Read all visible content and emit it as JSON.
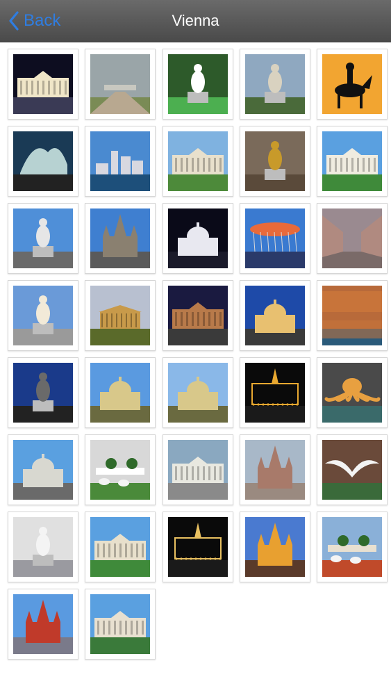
{
  "nav": {
    "back_label": "Back",
    "title": "Vienna",
    "accent_color": "#2f7de1"
  },
  "photos": [
    {
      "name": "parliament-night",
      "sky": "#0d0d20",
      "ground": "#3a3a55",
      "subject": "#f0e6c8",
      "kind": "building"
    },
    {
      "name": "belvedere-garden-cloudy",
      "sky": "#9aa5a8",
      "ground": "#7a8b55",
      "subject": "#c8c8c0",
      "kind": "landscape"
    },
    {
      "name": "mozart-statue",
      "sky": "#2d5a2a",
      "ground": "#4caf50",
      "subject": "#ffffff",
      "kind": "statue"
    },
    {
      "name": "strauss-monument",
      "sky": "#8fa8c0",
      "ground": "#4a6a3a",
      "subject": "#d9d2c0",
      "kind": "monument"
    },
    {
      "name": "equestrian-silhouette",
      "sky": "#f2a531",
      "ground": "#f2a531",
      "subject": "#111111",
      "kind": "silhouette"
    },
    {
      "name": "fountain-night",
      "sky": "#1a3a55",
      "ground": "#222222",
      "subject": "#c9e3e0",
      "kind": "fountain"
    },
    {
      "name": "danube-city",
      "sky": "#4a8ad0",
      "ground": "#1d4f7a",
      "subject": "#d8d8e0",
      "kind": "city"
    },
    {
      "name": "schonbrunn-palace",
      "sky": "#7fb2e0",
      "ground": "#4d8a3a",
      "subject": "#e8e0cc",
      "kind": "palace"
    },
    {
      "name": "golden-sculpture",
      "sky": "#7a6a5a",
      "ground": "#5a4a3a",
      "subject": "#c89a2a",
      "kind": "sculpture"
    },
    {
      "name": "belvedere-blue-sky",
      "sky": "#5aa0e0",
      "ground": "#3f8a3a",
      "subject": "#f0ece0",
      "kind": "palace"
    },
    {
      "name": "pallas-athene-fountain",
      "sky": "#4f8fd8",
      "ground": "#6a6a6a",
      "subject": "#e6e6e6",
      "kind": "statue"
    },
    {
      "name": "st-stephens-cathedral",
      "sky": "#3f7fd0",
      "ground": "#5a5a5a",
      "subject": "#8a8070",
      "kind": "church"
    },
    {
      "name": "karlskirche-night",
      "sky": "#0a0a18",
      "ground": "#1a1a2a",
      "subject": "#e8e8f0",
      "kind": "dome"
    },
    {
      "name": "prater-swing-ride",
      "sky": "#3a7ad0",
      "ground": "#2a3a6a",
      "subject": "#e86a3a",
      "kind": "ride"
    },
    {
      "name": "kartner-strasse",
      "sky": "#9a8a90",
      "ground": "#7a6a68",
      "subject": "#b08a80",
      "kind": "street"
    },
    {
      "name": "athena-statue",
      "sky": "#6a9ad8",
      "ground": "#9a9a9a",
      "subject": "#f2ead8",
      "kind": "statue"
    },
    {
      "name": "theseus-temple",
      "sky": "#b8c0d0",
      "ground": "#5a6a2a",
      "subject": "#c89a4a",
      "kind": "temple"
    },
    {
      "name": "opera-evening",
      "sky": "#1a1a40",
      "ground": "#3a3a3a",
      "subject": "#b87a4a",
      "kind": "building"
    },
    {
      "name": "natural-history-museum",
      "sky": "#1e4aa8",
      "ground": "#3a3a3a",
      "subject": "#e8c070",
      "kind": "dome"
    },
    {
      "name": "reflecting-building",
      "sky": "#b86a3a",
      "ground": "#2a5a7a",
      "subject": "#c8743a",
      "kind": "reflection"
    },
    {
      "name": "statue-blue-night",
      "sky": "#1a3a8a",
      "ground": "#222222",
      "subject": "#6a6a6a",
      "kind": "statue"
    },
    {
      "name": "hofburg-dome",
      "sky": "#5a9ae0",
      "ground": "#6a6a40",
      "subject": "#d8c88a",
      "kind": "dome"
    },
    {
      "name": "hofburg-green-dome",
      "sky": "#8ab8e8",
      "ground": "#6a6a40",
      "subject": "#d8c88a",
      "kind": "dome"
    },
    {
      "name": "rathaus-night",
      "sky": "#0a0a0a",
      "ground": "#1a1a1a",
      "subject": "#e8a830",
      "kind": "lights"
    },
    {
      "name": "octopus-fountain",
      "sky": "#4a4a4a",
      "ground": "#3a6a6a",
      "subject": "#e8a040",
      "kind": "octopus"
    },
    {
      "name": "karlskirche-day",
      "sky": "#5aa0e0",
      "ground": "#6a6a6a",
      "subject": "#d8d8d0",
      "kind": "dome"
    },
    {
      "name": "garden-flower-pots",
      "sky": "#d8d8d8",
      "ground": "#4a8a3a",
      "subject": "#ffffff",
      "kind": "garden"
    },
    {
      "name": "parliament-day",
      "sky": "#8aa8c0",
      "ground": "#8a8a8a",
      "subject": "#e8e8e0",
      "kind": "building"
    },
    {
      "name": "votivkirche",
      "sky": "#a8b8c8",
      "ground": "#9a8a80",
      "subject": "#a87a6a",
      "kind": "church"
    },
    {
      "name": "seagull-flight",
      "sky": "#6a4a3a",
      "ground": "#3a6a3a",
      "subject": "#f4f4f4",
      "kind": "bird"
    },
    {
      "name": "marble-sculpture",
      "sky": "#e0e0e0",
      "ground": "#9a9aa0",
      "subject": "#f4f4f4",
      "kind": "statue"
    },
    {
      "name": "belvedere-lawn",
      "sky": "#5aa0e0",
      "ground": "#3f8a3a",
      "subject": "#e8e0cc",
      "kind": "palace"
    },
    {
      "name": "colosseum-lights",
      "sky": "#0a0a0a",
      "ground": "#1a1a1a",
      "subject": "#e8c060",
      "kind": "lights"
    },
    {
      "name": "russian-church",
      "sky": "#4a7ad0",
      "ground": "#5a3a2a",
      "subject": "#e8a030",
      "kind": "church"
    },
    {
      "name": "schonbrunn-flowerbeds",
      "sky": "#8ab0d8",
      "ground": "#c04a2a",
      "subject": "#e8e0d0",
      "kind": "garden"
    },
    {
      "name": "red-castle",
      "sky": "#5a9ae0",
      "ground": "#7a7a8a",
      "subject": "#c03a2a",
      "kind": "castle"
    },
    {
      "name": "palace-park-statue",
      "sky": "#5aa0e0",
      "ground": "#3a7a3a",
      "subject": "#e8e0d0",
      "kind": "palace"
    }
  ]
}
